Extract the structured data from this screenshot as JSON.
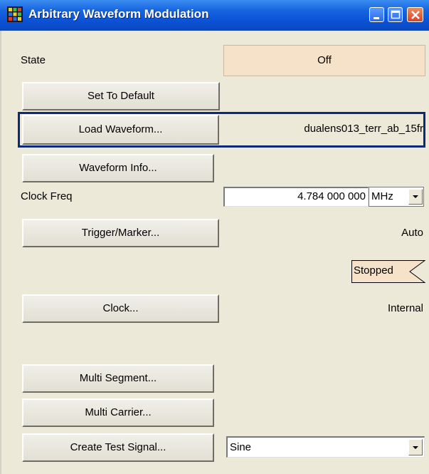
{
  "window": {
    "title": "Arbitrary Waveform Modulation",
    "icon": "grid-app-icon",
    "controls": [
      "minimize-icon",
      "maximize-icon",
      "close-icon"
    ]
  },
  "state": {
    "label": "State",
    "value": "Off",
    "color": "#f6e2c8"
  },
  "buttons": {
    "set_default": "Set To Default",
    "load_waveform": "Load Waveform...",
    "waveform_info": "Waveform Info...",
    "trigger_marker": "Trigger/Marker...",
    "clock": "Clock...",
    "multi_segment": "Multi Segment...",
    "multi_carrier": "Multi Carrier...",
    "create_test_signal": "Create Test Signal..."
  },
  "waveform_file": "dualens013_terr_ab_15fr",
  "clock_freq": {
    "label": "Clock Freq",
    "value": "4.784 000 000",
    "unit": "MHz"
  },
  "trigger_mode": "Auto",
  "trigger_status": "Stopped",
  "clock_source": "Internal",
  "test_signal": {
    "selected": "Sine"
  },
  "colors": {
    "titlebar": "#0a52d6",
    "focus": "#0b2a7a",
    "panel": "#ece9d8"
  }
}
